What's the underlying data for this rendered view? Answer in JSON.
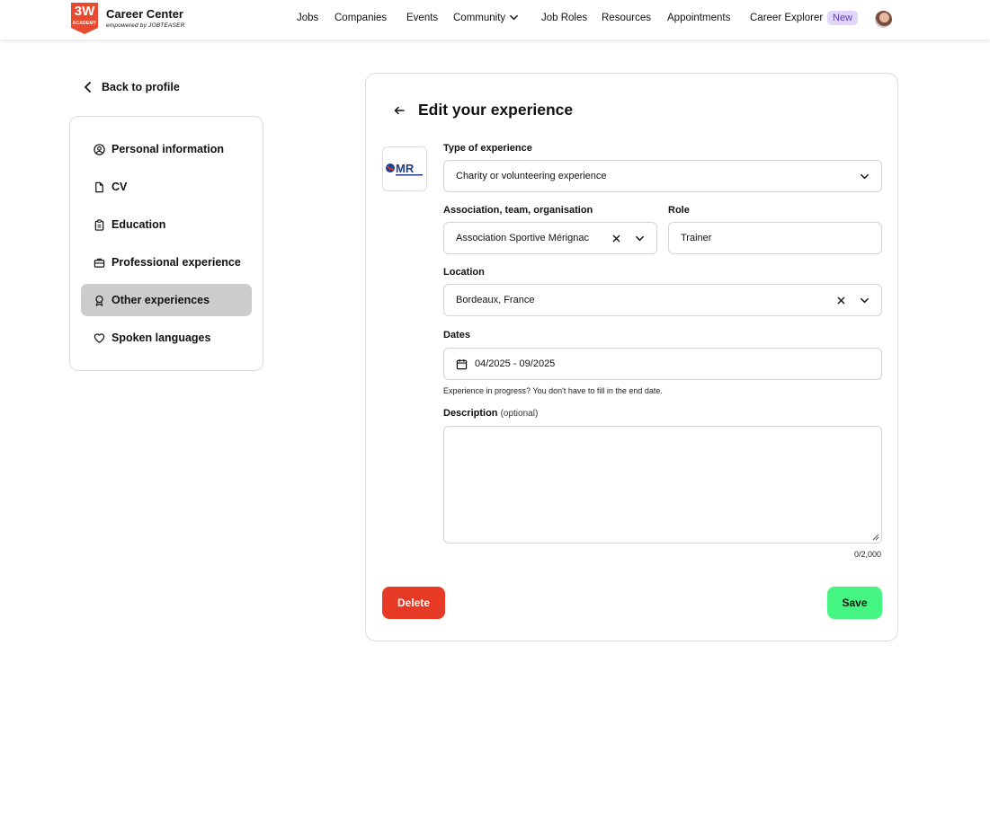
{
  "header": {
    "logo_text": "3W",
    "logo_subtext": "ACADEMY",
    "brand_title": "Career Center",
    "brand_subtitle": "empowered by JOBTEASER",
    "nav": [
      {
        "label": "Jobs"
      },
      {
        "label": "Companies"
      },
      {
        "label": "Events"
      },
      {
        "label": "Community"
      },
      {
        "label": "Job Roles"
      },
      {
        "label": "Resources"
      },
      {
        "label": "Appointments"
      },
      {
        "label": "Career Explorer"
      }
    ],
    "new_badge": "New",
    "avatar_icon": "user-avatar"
  },
  "sidebar": {
    "back_label": "Back to profile",
    "items": [
      {
        "label": "Personal information",
        "icon": "user-circle-icon"
      },
      {
        "label": "CV",
        "icon": "file-icon"
      },
      {
        "label": "Education",
        "icon": "clipboard-icon"
      },
      {
        "label": "Professional experience",
        "icon": "briefcase-icon"
      },
      {
        "label": "Other experiences",
        "icon": "award-icon",
        "active": true
      },
      {
        "label": "Spoken languages",
        "icon": "heart-icon"
      }
    ]
  },
  "form": {
    "title": "Edit your experience",
    "org_logo_text": "MR",
    "type": {
      "label": "Type of experience",
      "value": "Charity or volunteering experience"
    },
    "organisation": {
      "label": "Association, team, organisation",
      "value": "Association Sportive Mérignac"
    },
    "role": {
      "label": "Role",
      "value": "Trainer"
    },
    "location": {
      "label": "Location",
      "value": "Bordeaux, France"
    },
    "dates": {
      "label": "Dates",
      "value": "04/2025 - 09/2025",
      "helper": "Experience in progress? You don't have to fill in the end date."
    },
    "description": {
      "label": "Description",
      "optional": "(optional)",
      "value": "",
      "counter": "0/2,000"
    },
    "delete_label": "Delete",
    "save_label": "Save"
  },
  "colors": {
    "delete": "#e63a26",
    "save": "#45f582",
    "active_item": "#cccccc",
    "brand": "#e8492f",
    "new_badge_bg": "#e2d6fb"
  }
}
